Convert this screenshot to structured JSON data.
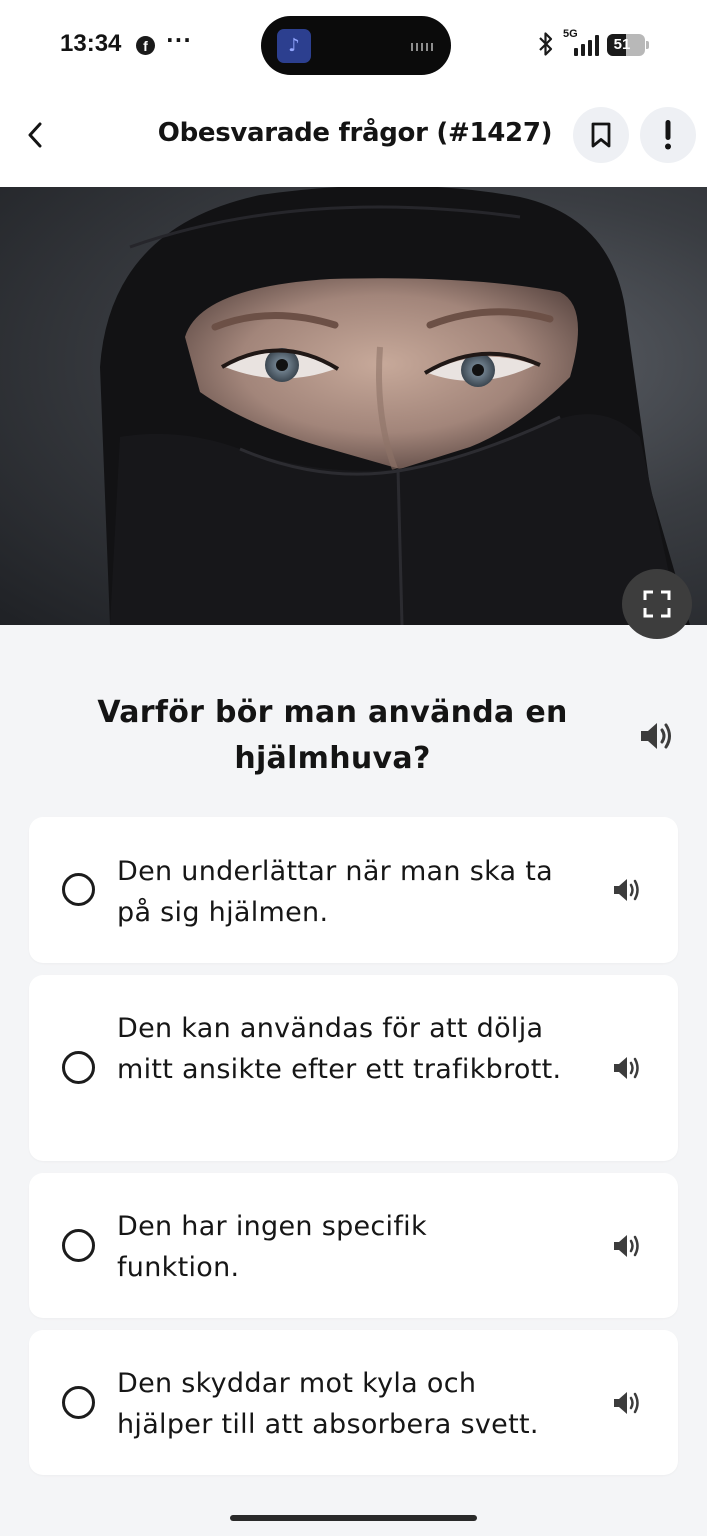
{
  "status_bar": {
    "time": "13:34",
    "network": "5G",
    "battery": "51",
    "battery_level": 0.51,
    "icons": [
      "facebook-icon",
      "more-dots-icon",
      "music-icon",
      "bluetooth-icon",
      "signal-icon",
      "battery-icon"
    ]
  },
  "header": {
    "title": "Obesvarade frågor (#1427)",
    "icons": [
      "back-chevron-icon",
      "bookmark-icon",
      "exclamation-icon"
    ]
  },
  "image": {
    "icons": [
      "expand-icon"
    ]
  },
  "question": {
    "text": "Varför bör man använda en hjälmhuva?",
    "icon": "speaker-icon"
  },
  "answers": [
    {
      "text": "Den underlättar när man ska ta på sig hjälmen.",
      "icon": "speaker-icon"
    },
    {
      "text": "Den kan användas för att dölja mitt ansikte efter ett trafikbrott.",
      "icon": "speaker-icon"
    },
    {
      "text": "Den har ingen specifik funktion.",
      "icon": "speaker-icon"
    },
    {
      "text": "Den skyddar mot kyla och hjälper till att absorbera svett.",
      "icon": "speaker-icon"
    }
  ],
  "colors": {
    "background": "#f4f5f7",
    "card": "#ffffff",
    "text": "#141414",
    "round_button": "#eef0f4"
  }
}
